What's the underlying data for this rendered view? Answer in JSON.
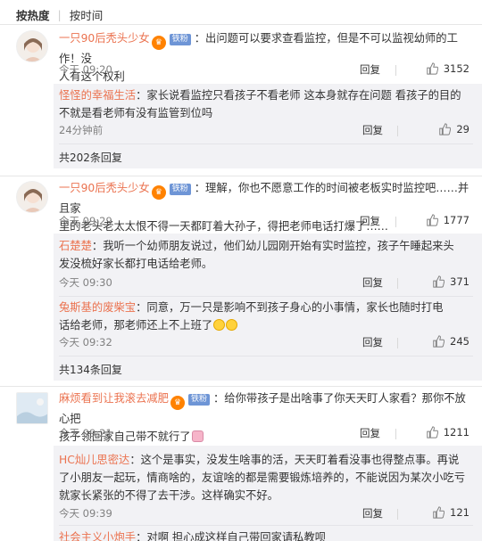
{
  "sort": {
    "hot": "按热度",
    "time": "按时间"
  },
  "comments": [
    {
      "user": "一只90后秃头少女",
      "vip_tag": "铁粉",
      "text_1": "：出问题可以要求查看监控，但是不可以监视幼师的工作！没",
      "text_2": "人有这个权利",
      "time": "今天 09:20",
      "reply": "回复",
      "likes": "3152",
      "subs": [
        {
          "user": "怪怪的幸福生活",
          "text_1": "：家长说看监控只看孩子不看老师 这本身就存在问题 看孩子的目的",
          "text_2": "不就是看老师有没有监管到位吗",
          "time": "24分钟前",
          "reply": "回复",
          "likes": "29"
        }
      ],
      "more": "共202条回复"
    },
    {
      "user": "一只90后秃头少女",
      "vip_tag": "铁粉",
      "text_1": "：理解，你也不愿意工作的时间被老板实时监控吧……并且家",
      "text_2": "里的老头老太太恨不得一天都盯着大孙子，得把老师电话打爆了……",
      "time": "今天 09:29",
      "reply": "回复",
      "likes": "1777",
      "subs": [
        {
          "user": "石楚楚",
          "text_1": "：我听一个幼师朋友说过，他们幼儿园刚开始有实时监控，孩子午睡起来头",
          "text_2": "发没梳好家长都打电话给老师。",
          "time": "今天 09:30",
          "reply": "回复",
          "likes": "371"
        },
        {
          "user": "兔斯基的废柴宝",
          "text_1": "：同意，万一只是影响不到孩子身心的小事情，家长也随时打电",
          "text_2": "话给老师，那老师还上不上班了",
          "time": "今天 09:32",
          "reply": "回复",
          "likes": "245"
        }
      ],
      "more": "共134条回复"
    },
    {
      "user": "麻烦看到让我滚去减肥",
      "vip_tag": "铁粉",
      "text_1": "：给你带孩子是出啥事了你天天盯人家看？那你不放心把",
      "text_2": "孩子领回家自己带不就行了",
      "time": "今天 09:21",
      "reply": "回复",
      "likes": "1211",
      "subs": [
        {
          "user": "HC灿儿思密达",
          "text_1": "：这个是事实，没发生啥事的活，天天盯着看没事也得整点事。再说",
          "text_2": "了小朋友一起玩，情商啥的，友谊啥的都是需要锻炼培养的，不能说因为某次小吃亏",
          "text_3": "就家长紧张的不得了去干涉。这样确实不好。",
          "time": "今天 09:39",
          "reply": "回复",
          "likes": "121"
        },
        {
          "user": "社会主义小炮手",
          "text_1": "：对啊 担心成这样自己带回家请私教呗"
        }
      ]
    }
  ],
  "colors": {
    "username": "#eb7350",
    "sub_bg": "#f2f2f5",
    "tag_bg": "#6e95d6",
    "badge": "#ff8200"
  },
  "icons": {
    "like": "thumbs-up-icon",
    "badge": "member-crown-icon"
  }
}
